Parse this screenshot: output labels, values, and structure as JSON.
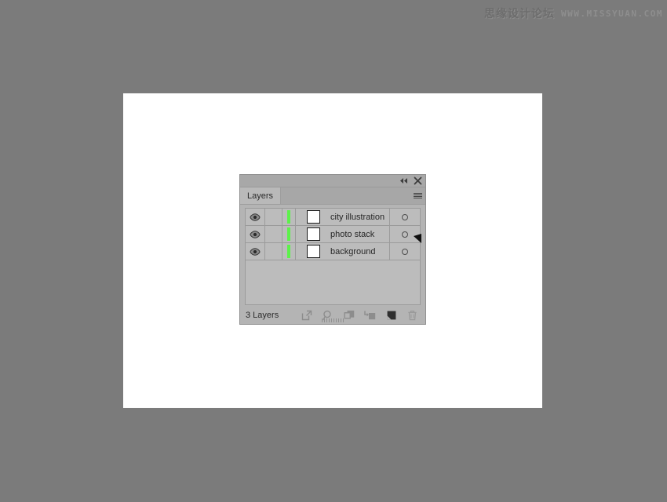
{
  "watermark": {
    "cn_text": "思缘设计论坛",
    "en_text": "WWW.MISSYUAN.COM"
  },
  "panel": {
    "titlebar": {
      "collapse_label": "◂◂",
      "collapse_icon": "double-chevron-left-icon",
      "close_icon": "close-icon"
    },
    "tab_label": "Layers",
    "menu_icon": "panel-menu-icon",
    "columns": {
      "visibility": "eye-icon",
      "lock": "lock-column",
      "color": "layer-color-bar",
      "thumbnail": "layer-thumbnail",
      "name": "layer-name",
      "target": "target-circle"
    },
    "layers": [
      {
        "name": "city illustration",
        "visible": true,
        "locked": false,
        "color": "#5cf24a",
        "thumbnail": "#ffffff",
        "targeted": false
      },
      {
        "name": "photo stack",
        "visible": true,
        "locked": false,
        "color": "#5cf24a",
        "thumbnail": "#ffffff",
        "targeted": false
      },
      {
        "name": "background",
        "visible": true,
        "locked": false,
        "color": "#5cf24a",
        "thumbnail": "#ffffff",
        "targeted": false
      }
    ],
    "footer": {
      "count_label": "3 Layers",
      "tools": [
        {
          "name": "locate-object-icon",
          "title": "Locate Object",
          "active": false
        },
        {
          "name": "search-icon",
          "title": "Find",
          "active": false
        },
        {
          "name": "make-clipping-mask-icon",
          "title": "Make/Release Clipping Mask",
          "active": false
        },
        {
          "name": "create-sublayer-icon",
          "title": "Create New Sublayer",
          "active": false
        },
        {
          "name": "create-new-layer-icon",
          "title": "Create New Layer",
          "active": true
        },
        {
          "name": "delete-selection-icon",
          "title": "Delete Selection",
          "active": false
        }
      ]
    }
  },
  "colors": {
    "desktop": "#7b7b7b",
    "canvas": "#ffffff",
    "panel_bg": "#b4b4b4",
    "row_bg": "#bcbcbc",
    "layer_accent": "#5cf24a"
  }
}
